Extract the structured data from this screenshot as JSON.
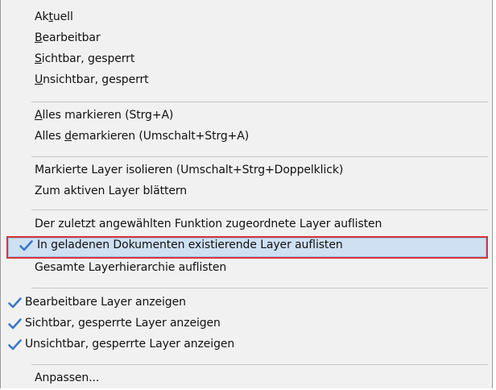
{
  "menu": {
    "group1": {
      "current": {
        "pre": "Ak",
        "ul": "t",
        "post": "uell"
      },
      "editable": {
        "pre": "",
        "ul": "B",
        "post": "earbeitbar"
      },
      "visible_locked": {
        "pre": "",
        "ul": "S",
        "post": "ichtbar, gesperrt"
      },
      "invisible_locked": {
        "pre": "",
        "ul": "U",
        "post": "nsichtbar, gesperrt"
      }
    },
    "group2": {
      "select_all": {
        "pre": "",
        "ul": "A",
        "post": "lles markieren (Strg+A)"
      },
      "deselect_all": {
        "pre": "Alles ",
        "ul": "d",
        "post": "emarkieren (Umschalt+Strg+A)"
      }
    },
    "group3": {
      "isolate": "Markierte Layer isolieren (Umschalt+Strg+Doppelklick)",
      "scroll_to_active": "Zum aktiven Layer blättern"
    },
    "group4": {
      "list_function": "Der zuletzt angewählten Funktion zugeordnete Layer auflisten",
      "list_loaded": "In geladenen Dokumenten existierende Layer auflisten",
      "list_all": "Gesamte Layerhierarchie auflisten"
    },
    "group5": {
      "show_editable": "Bearbeitbare Layer anzeigen",
      "show_visible_locked": "Sichtbar, gesperrte Layer anzeigen",
      "show_invisible_locked": "Unsichtbar, gesperrte Layer anzeigen"
    },
    "group6": {
      "customize": "Anpassen..."
    }
  },
  "colors": {
    "menu_background": "#f1f1f1",
    "highlight_fill": "#cfe0f3",
    "highlight_border": "#d9343c",
    "checkmark": "#3b77c7"
  },
  "icons": {
    "check": "checkmark-icon"
  }
}
